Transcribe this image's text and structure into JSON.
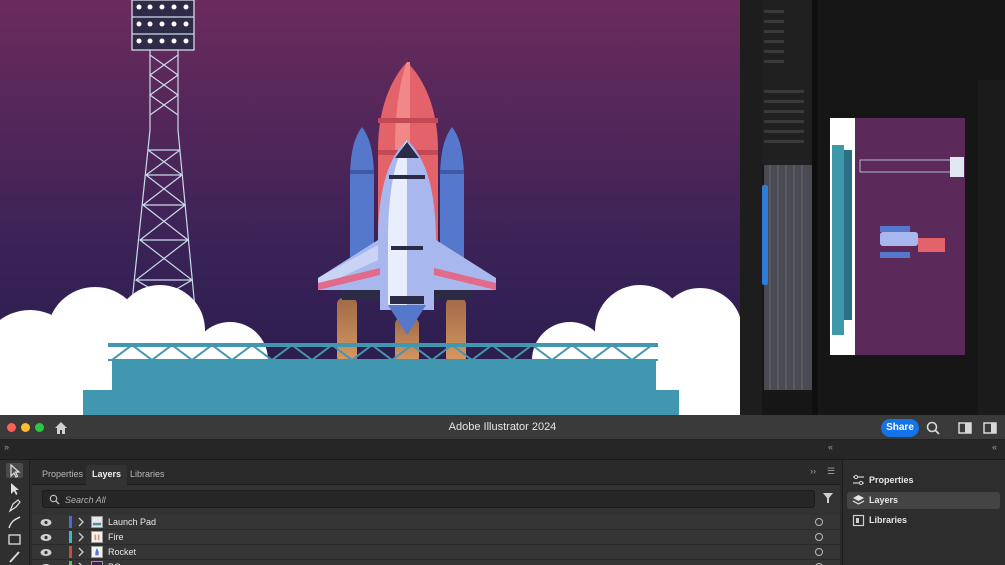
{
  "window": {
    "title": "Adobe Illustrator 2024",
    "share_label": "Share"
  },
  "panel": {
    "tabs": [
      {
        "label": "Properties",
        "active": false
      },
      {
        "label": "Layers",
        "active": true
      },
      {
        "label": "Libraries",
        "active": false
      }
    ],
    "search_placeholder": "Search All",
    "layers": [
      {
        "name": "Launch Pad",
        "color": "#4b6bd6"
      },
      {
        "name": "Fire",
        "color": "#3fb8c9"
      },
      {
        "name": "Rocket",
        "color": "#c94b4b"
      },
      {
        "name": "BG",
        "color": "#4bc94f"
      }
    ]
  },
  "right_panel": {
    "items": [
      {
        "label": "Properties",
        "icon": "properties-icon",
        "active": false
      },
      {
        "label": "Layers",
        "icon": "layers-icon",
        "active": true
      },
      {
        "label": "Libraries",
        "icon": "libraries-icon",
        "active": false
      }
    ]
  },
  "colors": {
    "accent": "#1473e6",
    "sky_top": "#6b2b5c",
    "sky_bottom": "#2b1e4d",
    "pad": "#4297b0"
  }
}
